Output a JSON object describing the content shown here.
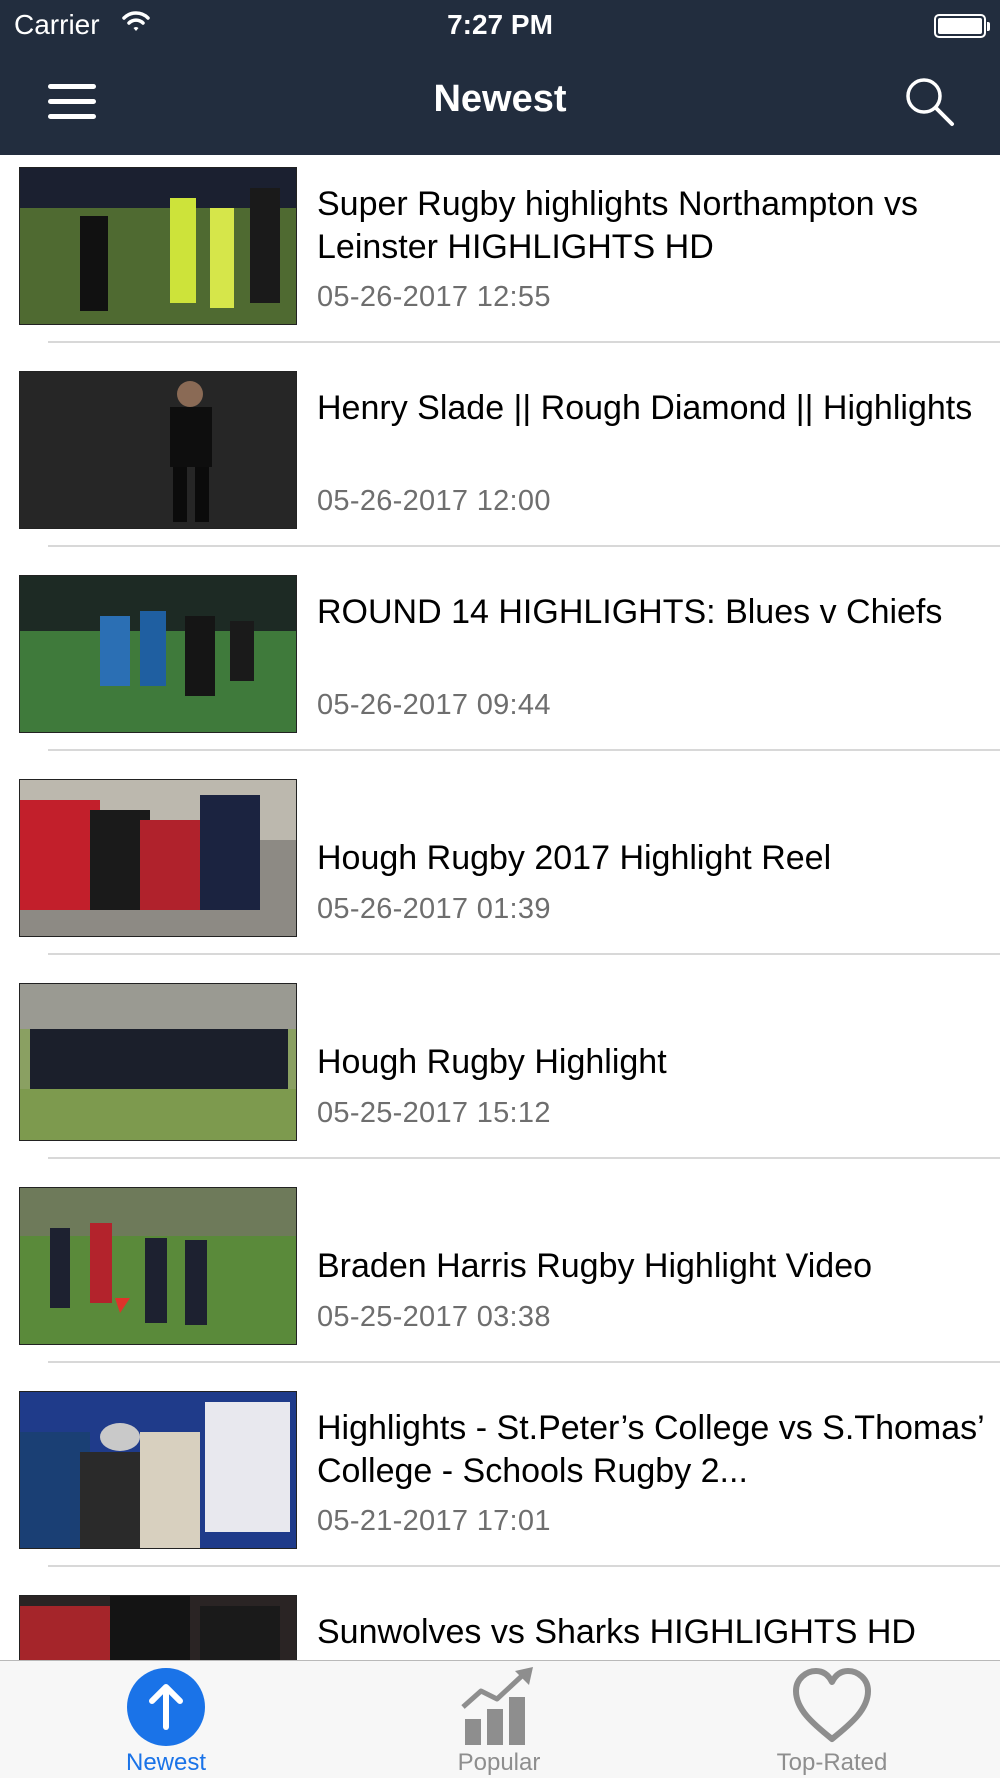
{
  "status_bar": {
    "carrier": "Carrier",
    "time": "7:27 PM"
  },
  "nav": {
    "title": "Newest",
    "menu_icon": "hamburger-menu-icon",
    "search_icon": "search-icon",
    "background": "#222d3e"
  },
  "videos": [
    {
      "title": "Super Rugby highlights Northampton vs Leinster   HIGHLIGHTS HD",
      "date": "05-26-2017 12:55"
    },
    {
      "title": "Henry Slade || Rough Diamond || Highlights",
      "date": "05-26-2017 12:00"
    },
    {
      "title": "ROUND 14 HIGHLIGHTS: Blues v Chiefs",
      "date": "05-26-2017 09:44"
    },
    {
      "title": "Hough Rugby 2017 Highlight Reel",
      "date": "05-26-2017 01:39"
    },
    {
      "title": "Hough Rugby Highlight",
      "date": "05-25-2017 15:12"
    },
    {
      "title": "Braden Harris Rugby Highlight Video",
      "date": "05-25-2017 03:38"
    },
    {
      "title": "Highlights - St.Peter’s College vs S.Thomas’ College - Schools Rugby 2...",
      "date": "05-21-2017 17:01"
    },
    {
      "title": "Sunwolves vs Sharks HIGHLIGHTS HD",
      "date": ""
    }
  ],
  "tabs": [
    {
      "label": "Newest",
      "icon": "arrow-up-circle-icon",
      "active": true
    },
    {
      "label": "Popular",
      "icon": "bar-chart-trend-icon",
      "active": false
    },
    {
      "label": "Top-Rated",
      "icon": "heart-icon",
      "active": false
    }
  ],
  "colors": {
    "accent": "#1a73e8",
    "inactive": "#8e8e8e",
    "date_text": "#6e6e6e"
  }
}
